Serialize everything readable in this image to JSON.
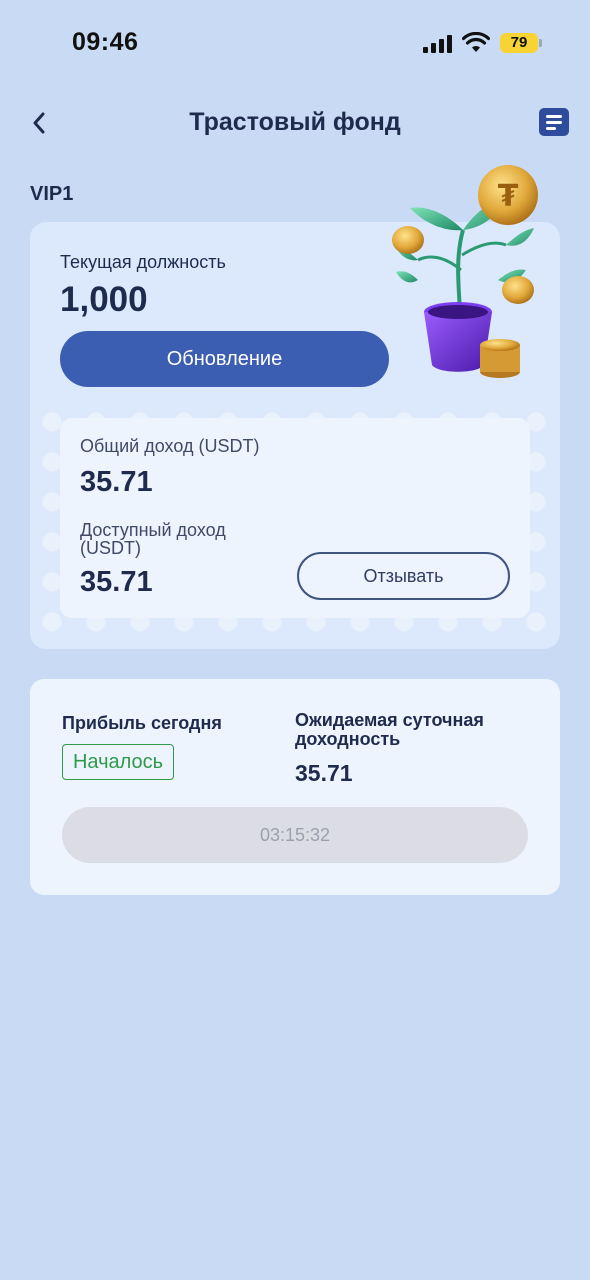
{
  "status_bar": {
    "time": "09:46",
    "battery": "79"
  },
  "header": {
    "title": "Трастовый фонд"
  },
  "vip": {
    "level": "VIP1"
  },
  "position_card": {
    "label": "Текущая должность",
    "value": "1,000",
    "upgrade_label": "Обновление"
  },
  "income": {
    "total_label": "Общий доход (USDT)",
    "total_value": "35.71",
    "available_label": "Доступный доход (USDT)",
    "available_value": "35.71",
    "withdraw_label": "Отзывать"
  },
  "profit": {
    "today_label": "Прибыль сегодня",
    "status": "Началось",
    "expected_label": "Ожидаемая суточная доходность",
    "expected_value": "35.71",
    "timer": "03:15:32"
  },
  "colors": {
    "background": "#c9dbf4",
    "primary": "#3c5eb2",
    "success": "#2f9a4a",
    "text": "#1f2b4d"
  },
  "icons": [
    "back-chevron-icon",
    "menu-list-icon",
    "signal-icon",
    "wifi-icon",
    "battery-icon",
    "money-plant-illustration"
  ]
}
